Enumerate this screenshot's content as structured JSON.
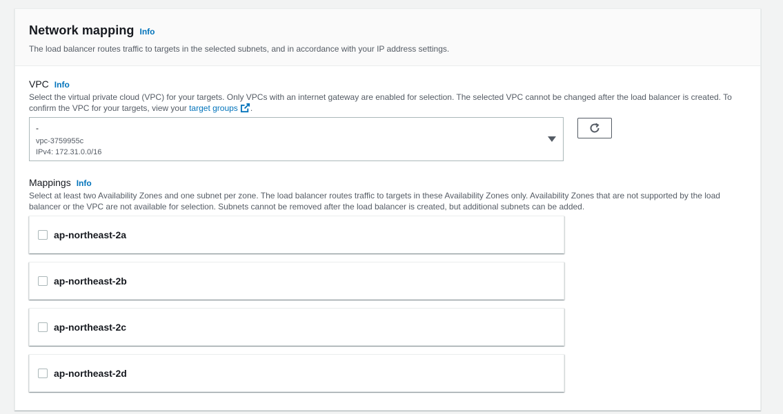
{
  "network_mapping": {
    "title": "Network mapping",
    "info": "Info",
    "description": "The load balancer routes traffic to targets in the selected subnets, and in accordance with your IP address settings."
  },
  "vpc": {
    "label": "VPC",
    "info": "Info",
    "description_before_link": "Select the virtual private cloud (VPC) for your targets. Only VPCs with an internet gateway are enabled for selection. The selected VPC cannot be changed after the load balancer is created. To confirm the VPC for your targets, view your ",
    "link_text": "target groups",
    "description_after_link": ".",
    "selected_name": "-",
    "selected_id": "vpc-3759955c",
    "selected_cidr": "IPv4: 172.31.0.0/16",
    "caret_icon": "caret-down-icon",
    "refresh_icon": "refresh-icon"
  },
  "mappings": {
    "label": "Mappings",
    "info": "Info",
    "description": "Select at least two Availability Zones and one subnet per zone. The load balancer routes traffic to targets in these Availability Zones only. Availability Zones that are not supported by the load balancer or the VPC are not available for selection. Subnets cannot be removed after the load balancer is created, but additional subnets can be added.",
    "zones": [
      {
        "name": "ap-northeast-2a",
        "checked": false
      },
      {
        "name": "ap-northeast-2b",
        "checked": false
      },
      {
        "name": "ap-northeast-2c",
        "checked": false
      },
      {
        "name": "ap-northeast-2d",
        "checked": false
      }
    ]
  },
  "colors": {
    "link": "#0073bb",
    "text": "#16191f",
    "secondary_text": "#545b64",
    "border": "#aab7b8"
  }
}
